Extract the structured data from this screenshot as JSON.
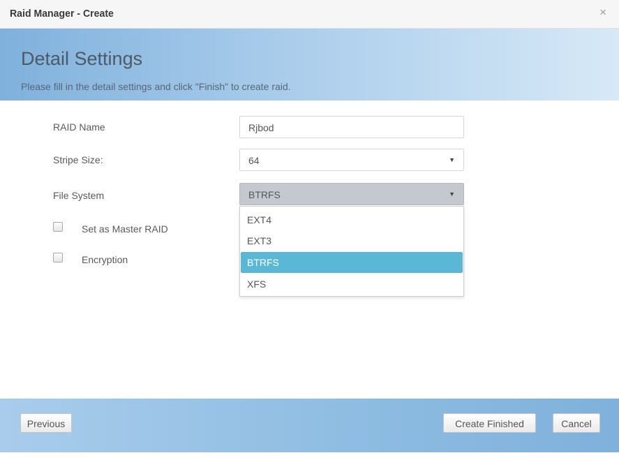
{
  "window": {
    "title": "Raid Manager - Create",
    "close_glyph": "×"
  },
  "banner": {
    "title": "Detail Settings",
    "subtitle": "Please fill in the detail settings and click \"Finish\" to create raid."
  },
  "form": {
    "raid_name": {
      "label": "RAID Name",
      "value": "Rjbod"
    },
    "stripe_size": {
      "label": "Stripe Size:",
      "value": "64"
    },
    "file_system": {
      "label": "File System",
      "value": "BTRFS",
      "options": [
        "EXT4",
        "EXT3",
        "BTRFS",
        "XFS"
      ],
      "selected": "BTRFS"
    },
    "master_raid": {
      "label": "Set as Master RAID",
      "checked": false
    },
    "encryption": {
      "label": "Encryption",
      "checked": false
    }
  },
  "footer": {
    "previous_label": "Previous",
    "create_label": "Create Finished",
    "cancel_label": "Cancel"
  },
  "icons": {
    "caret": "▼"
  },
  "colors": {
    "banner_start": "#7fb1dc",
    "banner_end": "#d7e9f7",
    "selection": "#5ab7d5",
    "open_select": "#c4c9d0"
  }
}
